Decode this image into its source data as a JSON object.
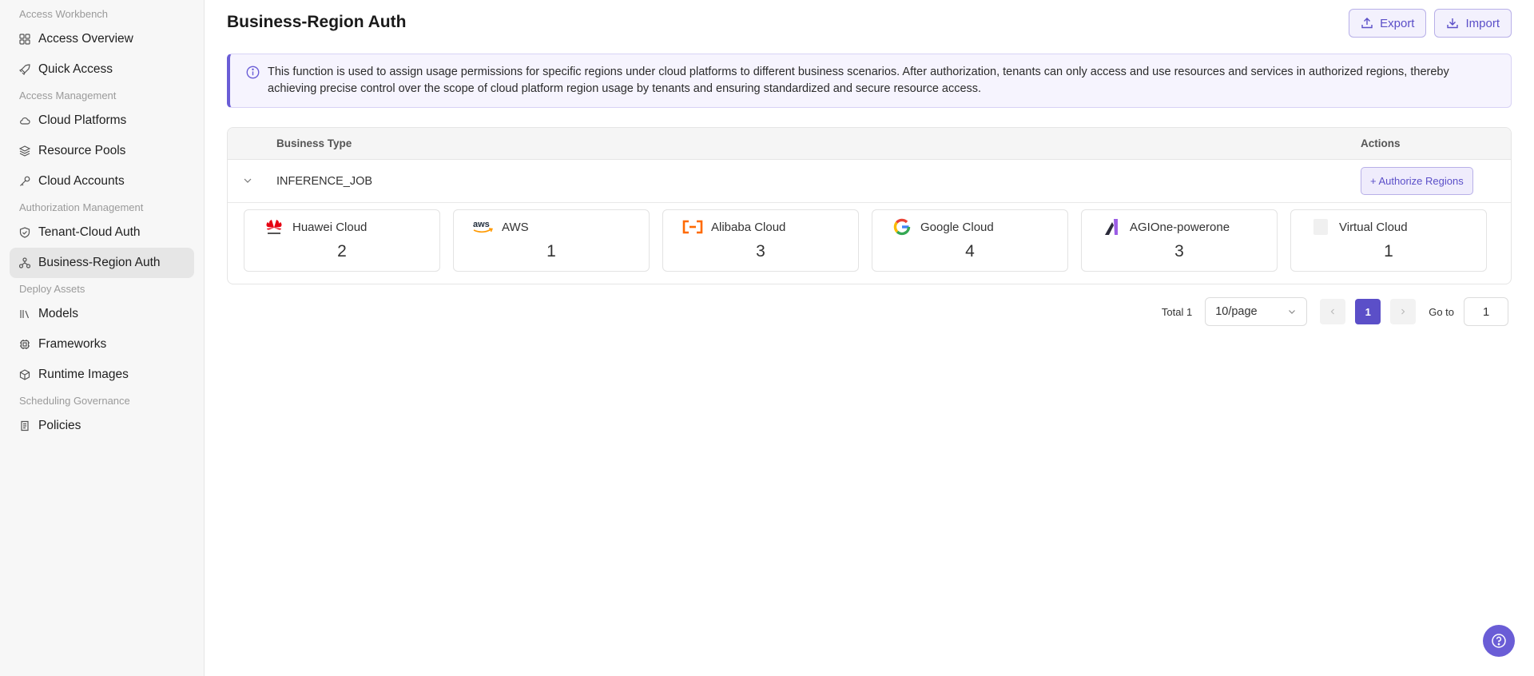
{
  "sidebar": {
    "groups": [
      {
        "label": "Access Workbench",
        "items": [
          "Access Overview",
          "Quick Access"
        ]
      },
      {
        "label": "Access Management",
        "items": [
          "Cloud Platforms",
          "Resource Pools",
          "Cloud Accounts"
        ]
      },
      {
        "label": "Authorization Management",
        "items": [
          "Tenant-Cloud Auth",
          "Business-Region Auth"
        ]
      },
      {
        "label": "Deploy Assets",
        "items": [
          "Models",
          "Frameworks",
          "Runtime Images"
        ]
      },
      {
        "label": "Scheduling Governance",
        "items": [
          "Policies"
        ]
      }
    ],
    "active": "Business-Region Auth"
  },
  "header": {
    "title": "Business-Region Auth",
    "export_label": "Export",
    "import_label": "Import"
  },
  "notice": {
    "text": "This function is used to assign usage permissions for specific regions under cloud platforms to different business scenarios. After authorization, tenants can only access and use resources and services in authorized regions, thereby achieving precise control over the scope of cloud platform region usage by tenants and ensuring standardized and secure resource access."
  },
  "table": {
    "columns": [
      "Business Type",
      "Actions"
    ],
    "rows": [
      {
        "business_type": "INFERENCE_JOB",
        "action_label": "+ Authorize Regions",
        "platforms": [
          {
            "name": "Huawei Cloud",
            "count": "2",
            "icon": "huawei-logo"
          },
          {
            "name": "AWS",
            "count": "1",
            "icon": "aws-logo"
          },
          {
            "name": "Alibaba Cloud",
            "count": "3",
            "icon": "alibaba-logo"
          },
          {
            "name": "Google Cloud",
            "count": "4",
            "icon": "google-logo"
          },
          {
            "name": "AGIOne-powerone",
            "count": "3",
            "icon": "agione-logo"
          },
          {
            "name": "Virtual Cloud",
            "count": "1",
            "icon": "placeholder-logo"
          }
        ]
      }
    ]
  },
  "pagination": {
    "total_label": "Total 1",
    "page_size": "10/page",
    "current_page": "1",
    "goto_label": "Go to",
    "goto_value": "1"
  },
  "colors": {
    "accent": "#5b4fc8",
    "accent_light": "#f3f1fd",
    "sidebar_bg": "#f7f7f7"
  }
}
